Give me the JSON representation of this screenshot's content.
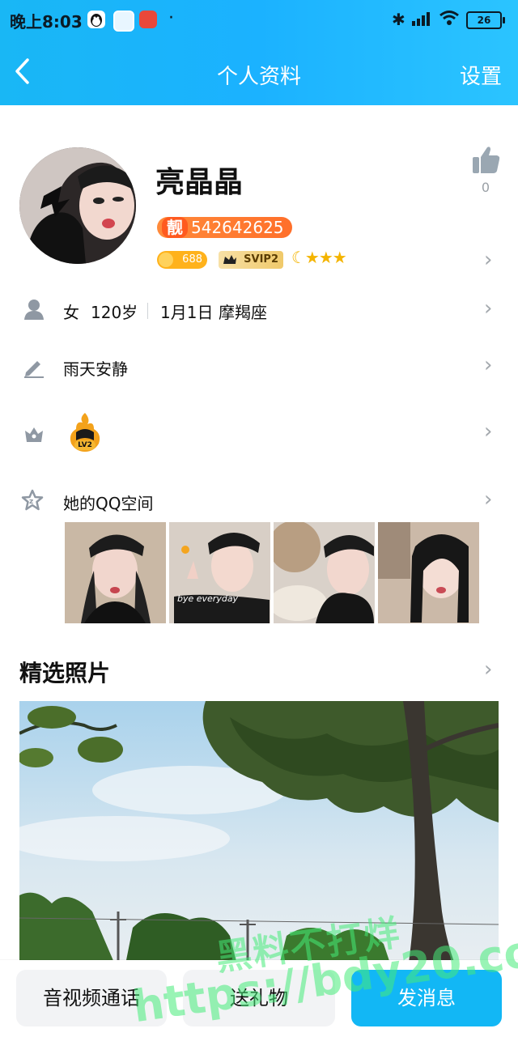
{
  "status_bar": {
    "time": "晚上8:03",
    "extra_dot": "·",
    "battery": "26"
  },
  "nav": {
    "back_icon": "chevron-left-icon",
    "title": "个人资料",
    "settings_label": "设置"
  },
  "profile": {
    "name": "亮晶晶",
    "pretty_badge": "靓",
    "qq_number": "542642625",
    "coin_value": "688",
    "svip_label": "SVIP2",
    "like_count": "0",
    "level_icons": "moon-star-icons"
  },
  "rows": {
    "basic": {
      "gender": "女",
      "age": "120岁",
      "birthday": "1月1日",
      "zodiac": "摩羯座"
    },
    "signature": "雨天安静",
    "badge_label": "LV2",
    "qzone_label": "她的QQ空间"
  },
  "qzone_thumbs": [
    "thumb-1",
    "thumb-2",
    "thumb-3",
    "thumb-4"
  ],
  "thumb_overlay_text": "bye everyday",
  "section": {
    "featured_photos_title": "精选照片"
  },
  "bottom_actions": {
    "call_label": "音视频通话",
    "gift_label": "送礼物",
    "message_label": "发消息"
  },
  "watermark": {
    "line1": "黑料不打烊",
    "line2": "https://bdy20.co"
  },
  "colors": {
    "accent": "#12b7f5",
    "pretty_badge": "#ff6f2a",
    "coin": "#ffb21b",
    "svip": "#f0c96a",
    "watermark": "#46eb78"
  }
}
